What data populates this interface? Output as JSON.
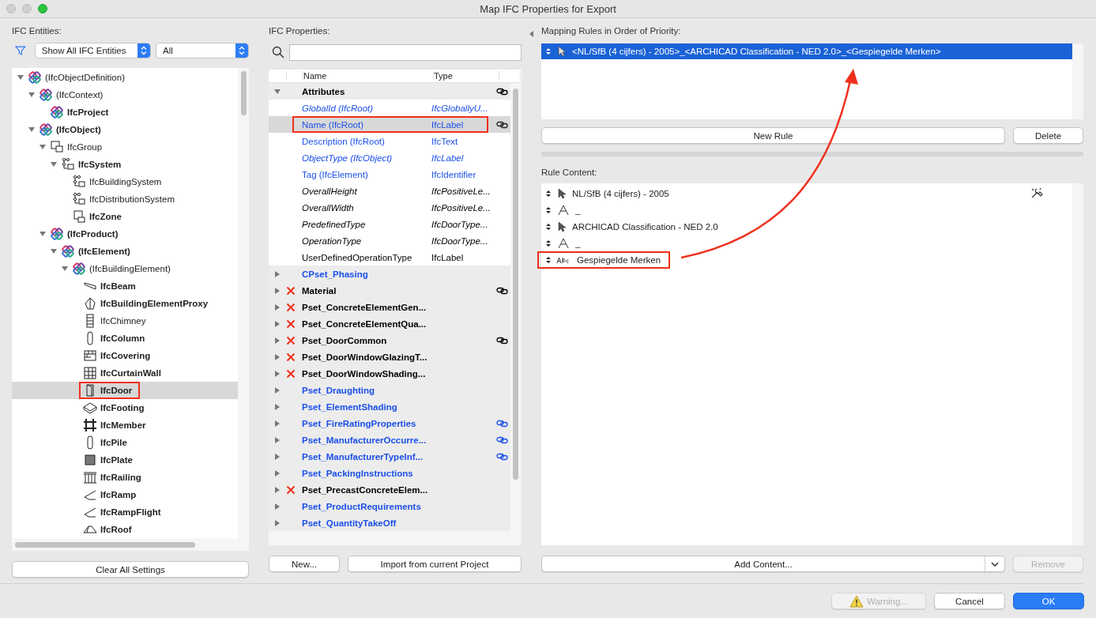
{
  "window": {
    "title": "Map IFC Properties for Export"
  },
  "entities": {
    "label": "IFC Entities:",
    "filter": "Show All IFC Entities",
    "scope": "All",
    "tree": [
      {
        "label": "(IfcObjectDefinition)",
        "kind": "ifc",
        "bold": false,
        "expanded": true,
        "selected": false,
        "annotated": false,
        "children": [
          {
            "label": "(IfcContext)",
            "kind": "ifc",
            "bold": false,
            "expanded": true,
            "selected": false,
            "annotated": false,
            "children": [
              {
                "label": "IfcProject",
                "kind": "ifc",
                "bold": true,
                "selected": false,
                "annotated": false
              }
            ]
          },
          {
            "label": "(IfcObject)",
            "kind": "ifc",
            "bold": true,
            "expanded": true,
            "selected": false,
            "annotated": false,
            "children": [
              {
                "label": "IfcGroup",
                "kind": "group",
                "bold": false,
                "expanded": true,
                "selected": false,
                "annotated": false,
                "children": [
                  {
                    "label": "IfcSystem",
                    "kind": "system",
                    "bold": true,
                    "expanded": true,
                    "selected": false,
                    "annotated": false,
                    "children": [
                      {
                        "label": "IfcBuildingSystem",
                        "kind": "system",
                        "bold": false,
                        "selected": false,
                        "annotated": false
                      },
                      {
                        "label": "IfcDistributionSystem",
                        "kind": "system",
                        "bold": false,
                        "selected": false,
                        "annotated": false
                      },
                      {
                        "label": "IfcZone",
                        "kind": "zone",
                        "bold": true,
                        "selected": false,
                        "annotated": false
                      }
                    ]
                  }
                ]
              },
              {
                "label": "(IfcProduct)",
                "kind": "ifc",
                "bold": true,
                "expanded": true,
                "selected": false,
                "annotated": false,
                "children": [
                  {
                    "label": "(IfcElement)",
                    "kind": "ifc",
                    "bold": true,
                    "expanded": true,
                    "selected": false,
                    "annotated": false,
                    "children": [
                      {
                        "label": "(IfcBuildingElement)",
                        "kind": "ifc",
                        "bold": false,
                        "expanded": true,
                        "selected": false,
                        "annotated": false,
                        "children": [
                          {
                            "label": "IfcBeam",
                            "kind": "beam",
                            "bold": true,
                            "selected": false,
                            "annotated": false
                          },
                          {
                            "label": "IfcBuildingElementProxy",
                            "kind": "proxy",
                            "bold": true,
                            "selected": false,
                            "annotated": false
                          },
                          {
                            "label": "IfcChimney",
                            "kind": "chimney",
                            "bold": false,
                            "selected": false,
                            "annotated": false
                          },
                          {
                            "label": "IfcColumn",
                            "kind": "column",
                            "bold": true,
                            "selected": false,
                            "annotated": false
                          },
                          {
                            "label": "IfcCovering",
                            "kind": "covering",
                            "bold": true,
                            "selected": false,
                            "annotated": false
                          },
                          {
                            "label": "IfcCurtainWall",
                            "kind": "grid",
                            "bold": true,
                            "selected": false,
                            "annotated": false
                          },
                          {
                            "label": "IfcDoor",
                            "kind": "door",
                            "bold": true,
                            "selected": true,
                            "annotated": true
                          },
                          {
                            "label": "IfcFooting",
                            "kind": "footing",
                            "bold": true,
                            "selected": false,
                            "annotated": false
                          },
                          {
                            "label": "IfcMember",
                            "kind": "member",
                            "bold": true,
                            "selected": false,
                            "annotated": false
                          },
                          {
                            "label": "IfcPile",
                            "kind": "column",
                            "bold": true,
                            "selected": false,
                            "annotated": false
                          },
                          {
                            "label": "IfcPlate",
                            "kind": "plate",
                            "bold": true,
                            "selected": false,
                            "annotated": false
                          },
                          {
                            "label": "IfcRailing",
                            "kind": "railing",
                            "bold": true,
                            "selected": false,
                            "annotated": false
                          },
                          {
                            "label": "IfcRamp",
                            "kind": "ramp",
                            "bold": true,
                            "selected": false,
                            "annotated": false
                          },
                          {
                            "label": "IfcRampFlight",
                            "kind": "ramp",
                            "bold": true,
                            "selected": false,
                            "annotated": false
                          },
                          {
                            "label": "IfcRoof",
                            "kind": "roof",
                            "bold": true,
                            "selected": false,
                            "annotated": false
                          }
                        ]
                      }
                    ]
                  }
                ]
              }
            ]
          }
        ]
      }
    ],
    "buttons": [
      "Clear All Settings"
    ]
  },
  "properties": {
    "label": "IFC Properties:",
    "columns": [
      "Name",
      "Type"
    ],
    "groups": [
      {
        "name": "Attributes",
        "expanded": true,
        "error": false,
        "linked": true,
        "color": "#000000",
        "children": [
          {
            "name": "GlobalId (IfcRoot)",
            "type": "IfcGloballyU...",
            "color": "#1a4fe8",
            "italic": true,
            "linked": false,
            "selected": false,
            "annotated": false
          },
          {
            "name": "Name (IfcRoot)",
            "type": "IfcLabel",
            "color": "#1a4fe8",
            "italic": false,
            "linked": true,
            "selected": true,
            "annotated": true
          },
          {
            "name": "Description (IfcRoot)",
            "type": "IfcText",
            "color": "#1a4fe8",
            "italic": false,
            "linked": false,
            "selected": false,
            "annotated": false
          },
          {
            "name": "ObjectType (IfcObject)",
            "type": "IfcLabel",
            "color": "#1a4fe8",
            "italic": true,
            "linked": false,
            "selected": false,
            "annotated": false
          },
          {
            "name": "Tag (IfcElement)",
            "type": "IfcIdentifier",
            "color": "#1a4fe8",
            "italic": false,
            "linked": false,
            "selected": false,
            "annotated": false
          },
          {
            "name": "OverallHeight",
            "type": "IfcPositiveLe...",
            "color": "#000000",
            "italic": true,
            "linked": false,
            "selected": false,
            "annotated": false
          },
          {
            "name": "OverallWidth",
            "type": "IfcPositiveLe...",
            "color": "#000000",
            "italic": true,
            "linked": false,
            "selected": false,
            "annotated": false
          },
          {
            "name": "PredefinedType",
            "type": "IfcDoorType...",
            "color": "#000000",
            "italic": true,
            "linked": false,
            "selected": false,
            "annotated": false
          },
          {
            "name": "OperationType",
            "type": "IfcDoorType...",
            "color": "#000000",
            "italic": true,
            "linked": false,
            "selected": false,
            "annotated": false
          },
          {
            "name": "UserDefinedOperationType",
            "type": "IfcLabel",
            "color": "#000000",
            "italic": false,
            "linked": false,
            "selected": false,
            "annotated": false
          }
        ]
      },
      {
        "name": "CPset_Phasing",
        "expanded": false,
        "error": false,
        "linked": false,
        "color": "#1a4fe8"
      },
      {
        "name": "Material",
        "expanded": false,
        "error": true,
        "linked": true,
        "color": "#000000"
      },
      {
        "name": "Pset_ConcreteElementGen...",
        "expanded": false,
        "error": true,
        "linked": false,
        "color": "#000000"
      },
      {
        "name": "Pset_ConcreteElementQua...",
        "expanded": false,
        "error": true,
        "linked": false,
        "color": "#000000"
      },
      {
        "name": "Pset_DoorCommon",
        "expanded": false,
        "error": true,
        "linked": true,
        "color": "#000000"
      },
      {
        "name": "Pset_DoorWindowGlazingT...",
        "expanded": false,
        "error": true,
        "linked": false,
        "color": "#000000"
      },
      {
        "name": "Pset_DoorWindowShading...",
        "expanded": false,
        "error": true,
        "linked": false,
        "color": "#000000"
      },
      {
        "name": "Pset_Draughting",
        "expanded": false,
        "error": false,
        "linked": false,
        "color": "#1a4fe8"
      },
      {
        "name": "Pset_ElementShading",
        "expanded": false,
        "error": false,
        "linked": false,
        "color": "#1a4fe8"
      },
      {
        "name": "Pset_FireRatingProperties",
        "expanded": false,
        "error": false,
        "linked": true,
        "color": "#1a4fe8"
      },
      {
        "name": "Pset_ManufacturerOccurre...",
        "expanded": false,
        "error": false,
        "linked": true,
        "color": "#1a4fe8"
      },
      {
        "name": "Pset_ManufacturerTypeInf...",
        "expanded": false,
        "error": false,
        "linked": true,
        "color": "#1a4fe8"
      },
      {
        "name": "Pset_PackingInstructions",
        "expanded": false,
        "error": false,
        "linked": false,
        "color": "#1a4fe8"
      },
      {
        "name": "Pset_PrecastConcreteElem...",
        "expanded": false,
        "error": true,
        "linked": false,
        "color": "#000000"
      },
      {
        "name": "Pset_ProductRequirements",
        "expanded": false,
        "error": false,
        "linked": false,
        "color": "#1a4fe8"
      },
      {
        "name": "Pset_QuantityTakeOff",
        "expanded": false,
        "error": false,
        "linked": false,
        "color": "#1a4fe8"
      }
    ],
    "buttons": [
      "New...",
      "Import from current Project"
    ]
  },
  "mapping_rules": {
    "label": "Mapping Rules in Order of Priority:",
    "rules": [
      {
        "text": "<NL/SfB (4 cijfers) - 2005>_<ARCHICAD Classification - NED 2.0>_<Gespiegelde Merken>",
        "selected": true
      }
    ],
    "buttons": [
      "New Rule",
      "Delete"
    ]
  },
  "rule_content": {
    "label": "Rule Content:",
    "items": [
      {
        "kind": "property",
        "text": "NL/SfB (4 cijfers) - 2005",
        "tool": true,
        "annotated": false
      },
      {
        "kind": "text",
        "text": "_",
        "tool": false,
        "annotated": false
      },
      {
        "kind": "property",
        "text": "ARCHICAD Classification - NED 2.0",
        "tool": false,
        "annotated": false
      },
      {
        "kind": "text",
        "text": "_",
        "tool": false,
        "annotated": false
      },
      {
        "kind": "string",
        "text": "Gespiegelde Merken",
        "tool": false,
        "annotated": true
      }
    ],
    "add_button": "Add Content...",
    "remove_button": {
      "label": "Remove",
      "disabled": true
    }
  },
  "footer": {
    "warning": {
      "label": "Warning...",
      "disabled": true
    },
    "cancel": "Cancel",
    "ok": "OK"
  }
}
